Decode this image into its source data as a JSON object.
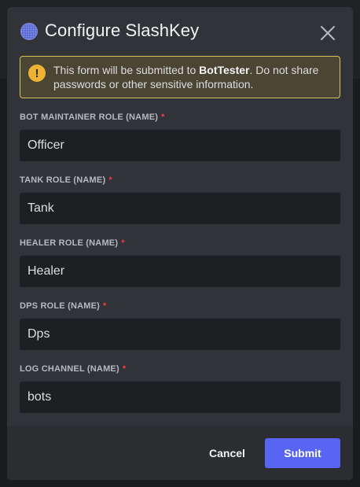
{
  "modal": {
    "title": "Configure SlashKey",
    "app_icon": "app-avatar-icon",
    "close_icon": "close-icon"
  },
  "warning": {
    "icon": "exclamation-icon",
    "text_before": "This form will be submitted to ",
    "bot_name": "BotTester",
    "text_after": ". Do not share passwords or other sensitive information."
  },
  "fields": [
    {
      "label": "BOT MAINTAINER ROLE (NAME)",
      "required_mark": "*",
      "value": "Officer"
    },
    {
      "label": "TANK ROLE (NAME)",
      "required_mark": "*",
      "value": "Tank"
    },
    {
      "label": "HEALER ROLE (NAME)",
      "required_mark": "*",
      "value": "Healer"
    },
    {
      "label": "DPS ROLE (NAME)",
      "required_mark": "*",
      "value": "Dps"
    },
    {
      "label": "LOG CHANNEL (NAME)",
      "required_mark": "*",
      "value": "bots"
    }
  ],
  "footer": {
    "cancel_label": "Cancel",
    "submit_label": "Submit"
  },
  "colors": {
    "accent": "#5865f2",
    "warning": "#f0b232",
    "required": "#f23f42"
  }
}
